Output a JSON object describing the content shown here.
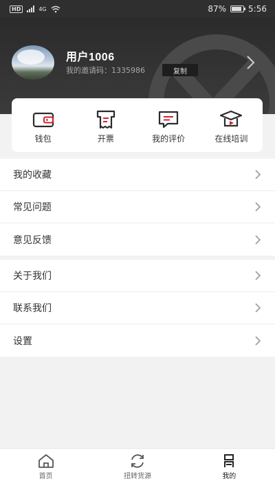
{
  "status_bar": {
    "signal": "4G",
    "battery_percent": "87%",
    "battery_level": 0.87,
    "time": "5:56"
  },
  "profile": {
    "username": "用户1006",
    "invite_label": "我的邀请码：",
    "invite_code": "1335986",
    "copy_label": "复制"
  },
  "quick_actions": [
    {
      "label": "钱包",
      "icon": "wallet-icon"
    },
    {
      "label": "开票",
      "icon": "invoice-icon"
    },
    {
      "label": "我的评价",
      "icon": "comment-icon"
    },
    {
      "label": "在线培训",
      "icon": "training-icon"
    }
  ],
  "menu_group_1": [
    {
      "label": "我的收藏"
    },
    {
      "label": "常见问题"
    },
    {
      "label": "意见反馈"
    }
  ],
  "menu_group_2": [
    {
      "label": "关于我们"
    },
    {
      "label": "联系我们"
    },
    {
      "label": "设置"
    }
  ],
  "tab_bar": [
    {
      "label": "首页",
      "icon": "home-icon"
    },
    {
      "label": "扭转货源",
      "icon": "refresh-icon"
    },
    {
      "label": "我的",
      "icon": "profile-icon",
      "active": true
    }
  ],
  "colors": {
    "accent": "#d0242b",
    "header_bg": "#2f2f2f",
    "page_bg": "#f2f2f2"
  }
}
